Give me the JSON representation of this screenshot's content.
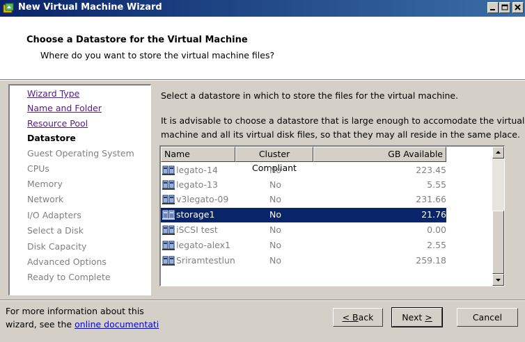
{
  "window": {
    "title": "New Virtual Machine Wizard",
    "buttons": [
      "minimize-icon",
      "maximize-icon",
      "close-icon"
    ],
    "accent": "#0a246a"
  },
  "header": {
    "title": "Choose a Datastore for the Virtual Machine",
    "subtitle": "Where do you want to store the virtual machine files?"
  },
  "steps": [
    {
      "label": "Wizard Type",
      "state": "link"
    },
    {
      "label": "Name and Folder",
      "state": "link"
    },
    {
      "label": "Resource Pool",
      "state": "link"
    },
    {
      "label": "Datastore",
      "state": "current"
    },
    {
      "label": "Guest Operating System",
      "state": "disabled"
    },
    {
      "label": "CPUs",
      "state": "disabled"
    },
    {
      "label": "Memory",
      "state": "disabled"
    },
    {
      "label": "Network",
      "state": "disabled"
    },
    {
      "label": "I/O Adapters",
      "state": "disabled"
    },
    {
      "label": "Select a Disk",
      "state": "disabled"
    },
    {
      "label": "Disk Capacity",
      "state": "disabled"
    },
    {
      "label": "Advanced Options",
      "state": "disabled"
    },
    {
      "label": "Ready to Complete",
      "state": "disabled"
    }
  ],
  "main": {
    "instruction": "Select a datastore in which to store the files for the virtual machine.",
    "advice_line1": "It is advisable to choose a datastore that is large enough to accomodate the virtual",
    "advice_line2": "machine and all its virtual disk files, so that they may all reside in the same place."
  },
  "table": {
    "columns": [
      "Name",
      "Cluster Compliant",
      "GB Available"
    ],
    "rows": [
      {
        "name": "legato-14",
        "cluster_compliant": "No",
        "gb_available": "223.45",
        "selected": false
      },
      {
        "name": "legato-13",
        "cluster_compliant": "No",
        "gb_available": "5.55",
        "selected": false
      },
      {
        "name": "v3legato-09",
        "cluster_compliant": "No",
        "gb_available": "231.66",
        "selected": false
      },
      {
        "name": "storage1",
        "cluster_compliant": "No",
        "gb_available": "21.76",
        "selected": true
      },
      {
        "name": "iSCSI test",
        "cluster_compliant": "No",
        "gb_available": "0.00",
        "selected": false
      },
      {
        "name": "legato-alex1",
        "cluster_compliant": "No",
        "gb_available": "2.55",
        "selected": false
      },
      {
        "name": "Sriramtestlun",
        "cluster_compliant": "No",
        "gb_available": "259.18",
        "selected": false
      }
    ],
    "row_icon": "datastore-icon"
  },
  "footer": {
    "help_line1": "For more information about this",
    "help_line2_prefix": "wizard, see the ",
    "help_link": "online documentati",
    "back": {
      "accel": "B",
      "rest": "ack",
      "prefix": "< "
    },
    "next": {
      "text": "Next ",
      "accel": ">"
    },
    "cancel": "Cancel"
  }
}
